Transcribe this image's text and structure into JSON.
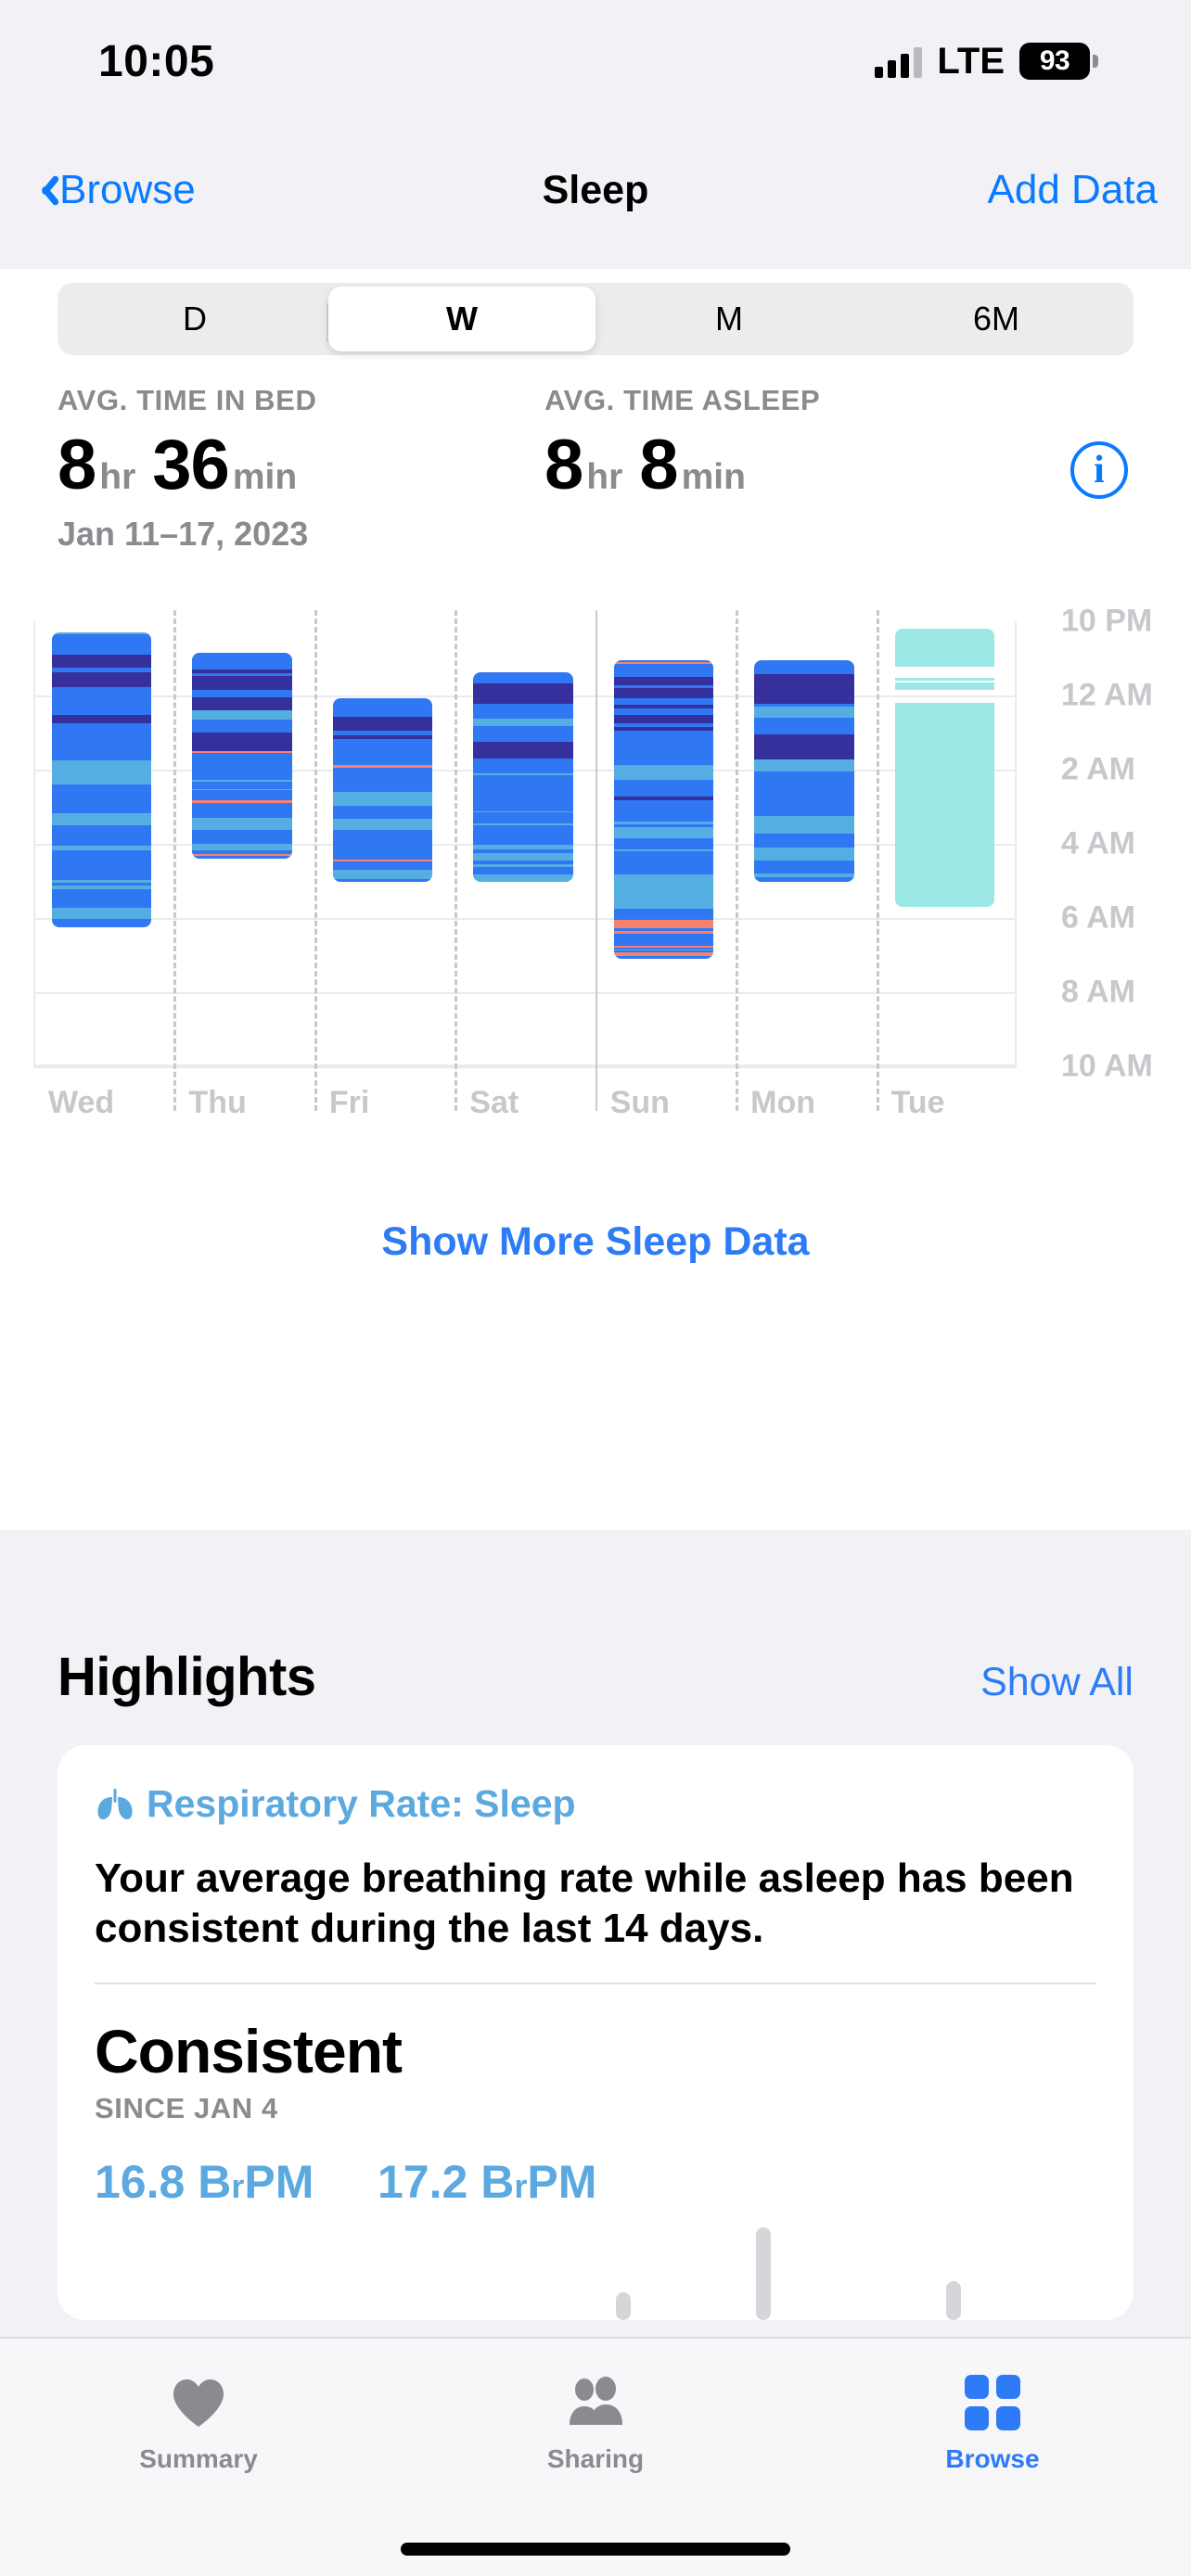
{
  "status_bar": {
    "time": "10:05",
    "carrier_type": "LTE",
    "battery_percent": "93",
    "signal_icon": "cellular-bars-icon",
    "battery_icon": "battery-icon"
  },
  "nav_bar": {
    "back_label": "Browse",
    "back_icon": "chevron-left-icon",
    "title": "Sleep",
    "action_label": "Add Data"
  },
  "range_selector": {
    "options": [
      "D",
      "W",
      "M",
      "6M"
    ],
    "selected": "W"
  },
  "summary": {
    "time_in_bed": {
      "label": "AVG. TIME IN BED",
      "hours": "8",
      "hours_unit": "hr",
      "minutes": "36",
      "minutes_unit": "min"
    },
    "time_asleep": {
      "label": "AVG. TIME ASLEEP",
      "hours": "8",
      "hours_unit": "hr",
      "minutes": "8",
      "minutes_unit": "min"
    },
    "date_range": "Jan 11–17, 2023",
    "info_icon": "info-circle-icon",
    "info_glyph": "i"
  },
  "chart_data": {
    "type": "bar",
    "title": "Weekly sleep stages",
    "xlabel": "",
    "ylabel": "",
    "grid": true,
    "legend_position": "none",
    "categories": [
      "Wed",
      "Thu",
      "Fri",
      "Sat",
      "Sun",
      "Mon",
      "Tue"
    ],
    "y_ticks": [
      "10 PM",
      "12 AM",
      "2 AM",
      "4 AM",
      "6 AM",
      "8 AM",
      "10 AM"
    ],
    "y_tick_hours": [
      22,
      24,
      26,
      28,
      30,
      32,
      34
    ],
    "ylim_hours": [
      22,
      34
    ],
    "stage_colors": {
      "awake": "#f8806f",
      "rem": "#55aee2",
      "core": "#3077f3",
      "deep": "#35309b",
      "in_bed": "#9ce8e4"
    },
    "series": [
      {
        "name": "Wed",
        "start_hour": 22.3,
        "end_hour": 30.25,
        "has_stage_data": true,
        "bands": [
          {
            "stage": "rem",
            "from": 22.3,
            "to": 22.34
          },
          {
            "stage": "core",
            "from": 22.34,
            "to": 22.9
          },
          {
            "stage": "deep",
            "from": 22.9,
            "to": 23.25
          },
          {
            "stage": "core",
            "from": 23.25,
            "to": 23.38
          },
          {
            "stage": "deep",
            "from": 23.38,
            "to": 23.78
          },
          {
            "stage": "core",
            "from": 23.78,
            "to": 24.52
          },
          {
            "stage": "deep",
            "from": 24.52,
            "to": 24.76
          },
          {
            "stage": "core",
            "from": 24.76,
            "to": 25.76
          },
          {
            "stage": "rem",
            "from": 25.76,
            "to": 26.4
          },
          {
            "stage": "core",
            "from": 26.4,
            "to": 27.18
          },
          {
            "stage": "rem",
            "from": 27.18,
            "to": 27.5
          },
          {
            "stage": "core",
            "from": 27.5,
            "to": 28.05
          },
          {
            "stage": "rem",
            "from": 28.05,
            "to": 28.18
          },
          {
            "stage": "core",
            "from": 28.18,
            "to": 28.98
          },
          {
            "stage": "rem",
            "from": 28.98,
            "to": 29.04
          },
          {
            "stage": "core",
            "from": 29.04,
            "to": 29.12
          },
          {
            "stage": "rem",
            "from": 29.12,
            "to": 29.22
          },
          {
            "stage": "core",
            "from": 29.22,
            "to": 29.72
          },
          {
            "stage": "rem",
            "from": 29.72,
            "to": 30.02
          },
          {
            "stage": "core",
            "from": 30.02,
            "to": 30.25
          }
        ]
      },
      {
        "name": "Thu",
        "start_hour": 22.86,
        "end_hour": 28.4,
        "has_stage_data": true,
        "bands": [
          {
            "stage": "core",
            "from": 22.86,
            "to": 23.3
          },
          {
            "stage": "deep",
            "from": 23.3,
            "to": 23.4
          },
          {
            "stage": "core",
            "from": 23.4,
            "to": 23.48
          },
          {
            "stage": "deep",
            "from": 23.48,
            "to": 23.84
          },
          {
            "stage": "core",
            "from": 23.84,
            "to": 24.06
          },
          {
            "stage": "deep",
            "from": 24.06,
            "to": 24.4
          },
          {
            "stage": "rem",
            "from": 24.4,
            "to": 24.66
          },
          {
            "stage": "core",
            "from": 24.66,
            "to": 25.0
          },
          {
            "stage": "deep",
            "from": 25.0,
            "to": 25.5
          },
          {
            "stage": "awake",
            "from": 25.5,
            "to": 25.54
          },
          {
            "stage": "core",
            "from": 25.54,
            "to": 26.28
          },
          {
            "stage": "rem",
            "from": 26.28,
            "to": 26.32
          },
          {
            "stage": "core",
            "from": 26.32,
            "to": 26.52
          },
          {
            "stage": "rem",
            "from": 26.52,
            "to": 26.56
          },
          {
            "stage": "core",
            "from": 26.56,
            "to": 26.82
          },
          {
            "stage": "awake",
            "from": 26.82,
            "to": 26.9
          },
          {
            "stage": "core",
            "from": 26.9,
            "to": 27.3
          },
          {
            "stage": "rem",
            "from": 27.3,
            "to": 27.62
          },
          {
            "stage": "core",
            "from": 27.62,
            "to": 28.0
          },
          {
            "stage": "rem",
            "from": 28.0,
            "to": 28.18
          },
          {
            "stage": "core",
            "from": 28.18,
            "to": 28.27
          },
          {
            "stage": "awake",
            "from": 28.27,
            "to": 28.32
          },
          {
            "stage": "core",
            "from": 28.32,
            "to": 28.4
          }
        ]
      },
      {
        "name": "Fri",
        "start_hour": 24.08,
        "end_hour": 29.02,
        "has_stage_data": true,
        "bands": [
          {
            "stage": "core",
            "from": 24.08,
            "to": 24.58
          },
          {
            "stage": "deep",
            "from": 24.58,
            "to": 24.95
          },
          {
            "stage": "core",
            "from": 24.95,
            "to": 25.08
          },
          {
            "stage": "deep",
            "from": 25.08,
            "to": 25.18
          },
          {
            "stage": "core",
            "from": 25.18,
            "to": 25.88
          },
          {
            "stage": "awake",
            "from": 25.88,
            "to": 25.94
          },
          {
            "stage": "core",
            "from": 25.94,
            "to": 26.6
          },
          {
            "stage": "rem",
            "from": 26.6,
            "to": 26.98
          },
          {
            "stage": "core",
            "from": 26.98,
            "to": 27.32
          },
          {
            "stage": "rem",
            "from": 27.32,
            "to": 27.62
          },
          {
            "stage": "core",
            "from": 27.62,
            "to": 28.42
          },
          {
            "stage": "awake",
            "from": 28.42,
            "to": 28.48
          },
          {
            "stage": "core",
            "from": 28.48,
            "to": 28.7
          },
          {
            "stage": "rem",
            "from": 28.7,
            "to": 28.94
          },
          {
            "stage": "core",
            "from": 28.94,
            "to": 29.02
          }
        ]
      },
      {
        "name": "Sat",
        "start_hour": 23.38,
        "end_hour": 29.02,
        "has_stage_data": true,
        "bands": [
          {
            "stage": "core",
            "from": 23.38,
            "to": 23.68
          },
          {
            "stage": "deep",
            "from": 23.68,
            "to": 24.22
          },
          {
            "stage": "core",
            "from": 24.22,
            "to": 24.62
          },
          {
            "stage": "rem",
            "from": 24.62,
            "to": 24.82
          },
          {
            "stage": "core",
            "from": 24.82,
            "to": 25.24
          },
          {
            "stage": "deep",
            "from": 25.24,
            "to": 25.7
          },
          {
            "stage": "core",
            "from": 25.7,
            "to": 26.1
          },
          {
            "stage": "rem",
            "from": 26.1,
            "to": 26.16
          },
          {
            "stage": "core",
            "from": 26.16,
            "to": 27.12
          },
          {
            "stage": "rem",
            "from": 27.12,
            "to": 27.16
          },
          {
            "stage": "core",
            "from": 27.16,
            "to": 27.44
          },
          {
            "stage": "rem",
            "from": 27.44,
            "to": 27.5
          },
          {
            "stage": "core",
            "from": 27.5,
            "to": 28.02
          },
          {
            "stage": "rem",
            "from": 28.02,
            "to": 28.14
          },
          {
            "stage": "core",
            "from": 28.14,
            "to": 28.26
          },
          {
            "stage": "rem",
            "from": 28.26,
            "to": 28.44
          },
          {
            "stage": "core",
            "from": 28.44,
            "to": 28.54
          },
          {
            "stage": "rem",
            "from": 28.54,
            "to": 28.62
          },
          {
            "stage": "core",
            "from": 28.62,
            "to": 28.82
          },
          {
            "stage": "rem",
            "from": 28.82,
            "to": 29.02
          }
        ]
      },
      {
        "name": "Sun",
        "start_hour": 23.05,
        "end_hour": 31.1,
        "has_stage_data": true,
        "bands": [
          {
            "stage": "core",
            "from": 23.05,
            "to": 23.1
          },
          {
            "stage": "awake",
            "from": 23.1,
            "to": 23.16
          },
          {
            "stage": "core",
            "from": 23.16,
            "to": 23.5
          },
          {
            "stage": "deep",
            "from": 23.5,
            "to": 23.72
          },
          {
            "stage": "core",
            "from": 23.72,
            "to": 23.8
          },
          {
            "stage": "deep",
            "from": 23.8,
            "to": 24.08
          },
          {
            "stage": "core",
            "from": 24.08,
            "to": 24.26
          },
          {
            "stage": "deep",
            "from": 24.26,
            "to": 24.36
          },
          {
            "stage": "core",
            "from": 24.36,
            "to": 24.52
          },
          {
            "stage": "deep",
            "from": 24.52,
            "to": 24.74
          },
          {
            "stage": "core",
            "from": 24.74,
            "to": 24.86
          },
          {
            "stage": "deep",
            "from": 24.86,
            "to": 24.96
          },
          {
            "stage": "core",
            "from": 24.96,
            "to": 25.88
          },
          {
            "stage": "rem",
            "from": 25.88,
            "to": 26.28
          },
          {
            "stage": "core",
            "from": 26.28,
            "to": 26.72
          },
          {
            "stage": "deep",
            "from": 26.72,
            "to": 26.82
          },
          {
            "stage": "core",
            "from": 26.82,
            "to": 27.4
          },
          {
            "stage": "rem",
            "from": 27.4,
            "to": 27.48
          },
          {
            "stage": "core",
            "from": 27.48,
            "to": 27.56
          },
          {
            "stage": "rem",
            "from": 27.56,
            "to": 27.84
          },
          {
            "stage": "core",
            "from": 27.84,
            "to": 28.14
          },
          {
            "stage": "rem",
            "from": 28.14,
            "to": 28.2
          },
          {
            "stage": "core",
            "from": 28.2,
            "to": 28.82
          },
          {
            "stage": "rem",
            "from": 28.82,
            "to": 29.74
          },
          {
            "stage": "core",
            "from": 29.74,
            "to": 30.04
          },
          {
            "stage": "awake",
            "from": 30.04,
            "to": 30.28
          },
          {
            "stage": "core",
            "from": 30.28,
            "to": 30.36
          },
          {
            "stage": "awake",
            "from": 30.36,
            "to": 30.42
          },
          {
            "stage": "core",
            "from": 30.42,
            "to": 30.76
          },
          {
            "stage": "awake",
            "from": 30.76,
            "to": 30.8
          },
          {
            "stage": "core",
            "from": 30.8,
            "to": 30.84
          },
          {
            "stage": "rem",
            "from": 30.84,
            "to": 30.88
          },
          {
            "stage": "core",
            "from": 30.88,
            "to": 30.92
          },
          {
            "stage": "awake",
            "from": 30.92,
            "to": 31.02
          },
          {
            "stage": "core",
            "from": 31.02,
            "to": 31.1
          }
        ]
      },
      {
        "name": "Mon",
        "start_hour": 23.05,
        "end_hour": 29.02,
        "has_stage_data": true,
        "bands": [
          {
            "stage": "core",
            "from": 23.05,
            "to": 23.42
          },
          {
            "stage": "deep",
            "from": 23.42,
            "to": 24.22
          },
          {
            "stage": "core",
            "from": 24.22,
            "to": 24.3
          },
          {
            "stage": "rem",
            "from": 24.3,
            "to": 24.6
          },
          {
            "stage": "core",
            "from": 24.6,
            "to": 25.04
          },
          {
            "stage": "deep",
            "from": 25.04,
            "to": 25.72
          },
          {
            "stage": "rem",
            "from": 25.72,
            "to": 26.04
          },
          {
            "stage": "core",
            "from": 26.04,
            "to": 26.4
          },
          {
            "stage": "core",
            "from": 26.4,
            "to": 27.24
          },
          {
            "stage": "rem",
            "from": 27.24,
            "to": 27.72
          },
          {
            "stage": "core",
            "from": 27.72,
            "to": 28.1
          },
          {
            "stage": "rem",
            "from": 28.1,
            "to": 28.44
          },
          {
            "stage": "core",
            "from": 28.44,
            "to": 28.8
          },
          {
            "stage": "rem",
            "from": 28.8,
            "to": 28.9
          },
          {
            "stage": "core",
            "from": 28.9,
            "to": 29.02
          }
        ]
      },
      {
        "name": "Tue",
        "start_hour": 22.2,
        "end_hour": 29.7,
        "has_stage_data": false,
        "bands": [
          {
            "stage": "in_bed",
            "from": 22.2,
            "to": 23.23
          },
          {
            "stage": "in_bed",
            "from": 23.52,
            "to": 23.59
          },
          {
            "stage": "in_bed",
            "from": 23.66,
            "to": 23.84
          },
          {
            "stage": "in_bed",
            "from": 24.2,
            "to": 29.7
          }
        ]
      }
    ]
  },
  "show_more_label": "Show More Sleep Data",
  "highlights": {
    "title": "Highlights",
    "show_all_label": "Show All",
    "card": {
      "kicker_icon": "lungs-icon",
      "kicker": "Respiratory Rate: Sleep",
      "body": "Your average breathing rate while asleep has been consistent during the last 14 days.",
      "verdict": "Consistent",
      "since": "SINCE JAN 4",
      "value_left": "16.8 B",
      "value_left_sc": "r",
      "value_left_tail": "PM",
      "value_right": "17.2 B",
      "value_right_sc": "r",
      "value_right_tail": "PM"
    }
  },
  "tab_bar": {
    "tabs": [
      {
        "label": "Summary",
        "icon": "heart-icon",
        "active": false
      },
      {
        "label": "Sharing",
        "icon": "people-icon",
        "active": false
      },
      {
        "label": "Browse",
        "icon": "grid-squares-icon",
        "active": true
      }
    ]
  }
}
